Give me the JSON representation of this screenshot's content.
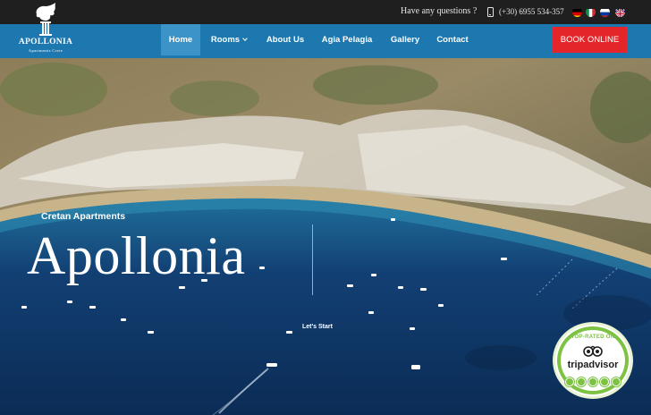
{
  "topbar": {
    "question": "Have any questions ?",
    "phone": "(+30) 6955 534-357",
    "languages": [
      "de",
      "it",
      "ru",
      "en"
    ]
  },
  "logo": {
    "name": "APOLLONIA",
    "tagline": "Apartments Crete"
  },
  "nav": {
    "items": [
      {
        "label": "Home",
        "active": true,
        "dropdown": false
      },
      {
        "label": "Rooms",
        "active": false,
        "dropdown": true
      },
      {
        "label": "About Us",
        "active": false,
        "dropdown": false
      },
      {
        "label": "Agia Pelagia",
        "active": false,
        "dropdown": false
      },
      {
        "label": "Gallery",
        "active": false,
        "dropdown": false
      },
      {
        "label": "Contact",
        "active": false,
        "dropdown": false
      }
    ],
    "book_label": "BOOK ONLINE"
  },
  "hero": {
    "subtitle": "Cretan Apartments",
    "title": "Apollonia",
    "cta": "Let's Start"
  },
  "badge": {
    "top_text": "TOP-RATED ON",
    "wordmark": "tripadvisor",
    "bubbles": 5
  },
  "colors": {
    "topbar": "#1f1f1f",
    "navbar": "#1d78b0",
    "nav_active": "#3b93c8",
    "book_button": "#e4262b",
    "sea": "#0e3a66",
    "tripadvisor_green": "#7dc242"
  }
}
